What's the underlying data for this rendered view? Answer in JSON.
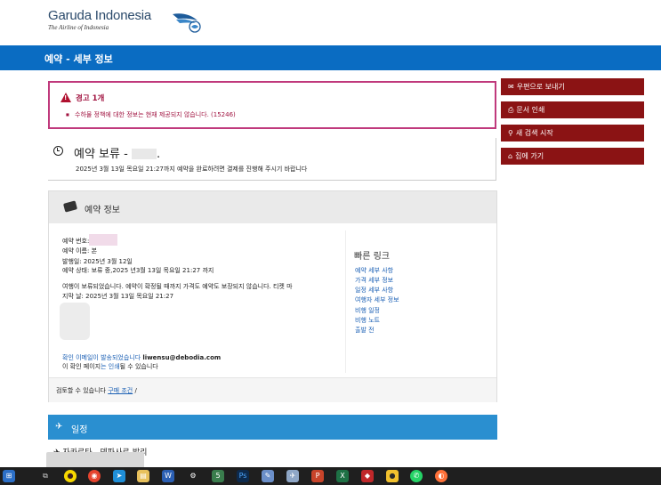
{
  "logo": {
    "name": "Garuda Indonesia",
    "tagline": "The Airline of Indonesia"
  },
  "titlebar": {
    "title": "예약 - 세부 정보"
  },
  "sidebar": {
    "items": [
      {
        "label": "우편으로 보내기",
        "icon": "envelope-icon"
      },
      {
        "label": "문서 인쇄",
        "icon": "printer-icon"
      },
      {
        "label": "새 검색 시작",
        "icon": "search-icon"
      },
      {
        "label": "집에 가기",
        "icon": "home-icon"
      }
    ]
  },
  "alert": {
    "title": "경고 1개",
    "message": "수하물 정책에 대한 정보는 현재 제공되지 않습니다. (15246)"
  },
  "booking_status": {
    "title": "예약 보류 -",
    "title_suffix": ".",
    "note": "2025년 3월 13일 목요일 21:27까지 예약을 완료하려면 결제를 진행해 주시기 바랍니다"
  },
  "booking_info": {
    "header": "예약 정보",
    "booking_number_label": "예약 번호:",
    "booking_name": "예약 이름: 본",
    "issue_date": "발행일: 2025년 3월 12일",
    "status_line": "예약 상태: 보류 중,2025 년3월 13일 목요일 21:27 까지",
    "notice_line1": "여행이 보류되었습니다. 예약이 확정될 때까지 가격도 예약도 보장되지 않습니다. 티켓 마",
    "notice_line2": "지막 날: 2025년 3월 13일 목요일 21:27",
    "email_line_prefix": "확인 이메일이 발송되었습니다",
    "email": "liwensu@debodia.com",
    "print_line_prefix": "이 확인 페이지",
    "print_link": "는 인쇄",
    "print_line_suffix": "될 수 있습니다",
    "footer_prefix": "검토할 수 있습니다",
    "footer_link": "구매 조건",
    "footer_suffix": "/"
  },
  "quick_links": {
    "title": "빠른 링크",
    "items": [
      "예약 세부 사항",
      "가격 세부 정보",
      "일정 세부 사항",
      "여행자 세부 정보",
      "비행 일정",
      "비행 노트",
      "출발 전"
    ]
  },
  "itinerary": {
    "header": "일정",
    "route": "자카르타 - 덴파사르-발리"
  },
  "taskbar": {
    "icons": [
      "start-icon",
      "task-view-icon",
      "kakaotalk-icon",
      "chrome-icon",
      "app-icon",
      "file-explorer-icon",
      "word-icon",
      "settings-icon",
      "app-icon",
      "photoshop-icon",
      "notepad-icon",
      "app-icon",
      "powerpoint-icon",
      "excel-icon",
      "app-icon",
      "app-icon",
      "whatsapp-icon",
      "firefox-icon"
    ]
  },
  "colors": {
    "brand_blue": "#0a6cc2",
    "button_red": "#8b1314",
    "alert_border": "#c0397c",
    "itinerary_blue": "#2a8fd0"
  }
}
